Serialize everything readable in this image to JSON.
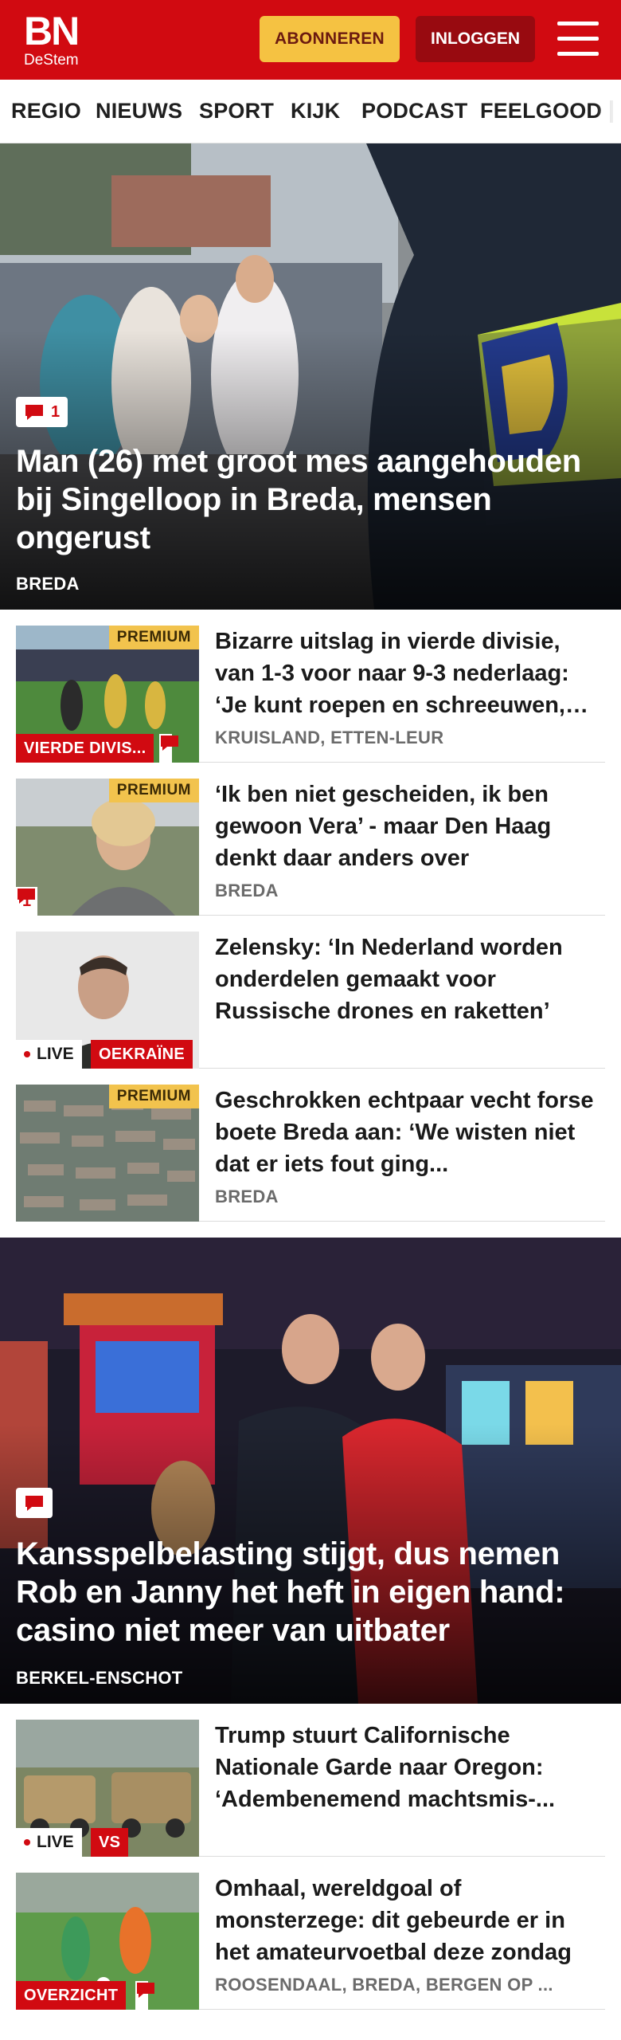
{
  "header": {
    "logo_main": "BN",
    "logo_sub": "DeStem",
    "subscribe_label": "ABONNEREN",
    "login_label": "INLOGGEN",
    "brand_color": "#d10a11",
    "menu_icon": "hamburger-menu-icon"
  },
  "nav": {
    "items": [
      "REGIO",
      "NIEUWS",
      "SPORT",
      "KIJK",
      "PODCAST",
      "FEELGOOD"
    ]
  },
  "hero1": {
    "comment_count": "1",
    "title": "Man (26) met groot mes aangehouden bij Singelloop in Breda, mensen ongerust",
    "tag": "BREDA"
  },
  "articles1": [
    {
      "premium": "PREMIUM",
      "label": "VIERDE DIVIS...",
      "title": "Bizarre uitslag in vierde divisie, van 1-3 voor naar 9-3 nederlaag: ‘Je kunt roepen en schreeuwen, maar...",
      "tag": "KRUISLAND, ETTEN-LEUR"
    },
    {
      "premium": "PREMIUM",
      "comment_count": "1",
      "title": "‘Ik ben niet gescheiden, ik ben gewoon Vera’ - maar Den Haag denkt daar anders over",
      "tag": "BREDA"
    },
    {
      "live": "LIVE",
      "label": "OEKRAÏNE",
      "title": "Zelensky: ‘In Nederland worden onderdelen gemaakt voor Russische drones en raketten’",
      "tag": ""
    },
    {
      "premium": "PREMIUM",
      "title": "Geschrokken echtpaar vecht forse boete Breda aan: ‘We wisten niet dat er iets fout ging...",
      "tag": "BREDA"
    }
  ],
  "hero2": {
    "title": "Kansspelbelasting stijgt, dus nemen Rob en Janny het heft in eigen hand: casino niet meer van uitbater",
    "tag": "BERKEL-ENSCHOT"
  },
  "articles2": [
    {
      "live": "LIVE",
      "label": "VS",
      "title": "Trump stuurt Californische Nationale Garde naar Oregon: ‘Adembenemend machtsmis-...",
      "tag": ""
    },
    {
      "label": "OVERZICHT",
      "title": "Omhaal, wereldgoal of monsterzege: dit gebeurde er in het amateurvoetbal deze zondag",
      "tag": "ROOSENDAAL, BREDA, BERGEN OP ..."
    }
  ]
}
